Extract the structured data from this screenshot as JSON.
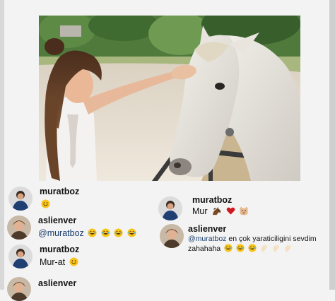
{
  "post": {
    "photo_alt_subjects": [
      "woman",
      "white-horse"
    ]
  },
  "comments_left": [
    {
      "username": "muratboz",
      "text": "",
      "emojis": [
        "smile-emoji"
      ]
    },
    {
      "username": "aslienver",
      "mention": "@muratboz",
      "text": "",
      "emojis": [
        "laugh-cry-emoji",
        "laugh-cry-emoji",
        "laugh-cry-emoji",
        "laugh-cry-emoji"
      ]
    },
    {
      "username": "muratboz",
      "text": "Mur-at",
      "emojis": [
        "smile-emoji"
      ]
    },
    {
      "username": "aslienver",
      "text": ""
    }
  ],
  "comments_right": [
    {
      "username": "muratboz",
      "text": "Mur",
      "emojis": [
        "horse-emoji",
        "red-heart-emoji",
        "cat-face-emoji"
      ]
    },
    {
      "username": "aslienver",
      "mention": "@muratboz",
      "text": "en çok yaraticiligini sevdim",
      "text2": "zahahaha",
      "emojis": [
        "laugh-cry-emoji",
        "laugh-cry-emoji",
        "laugh-cry-emoji",
        "clap-emoji",
        "clap-emoji",
        "clap-emoji"
      ]
    }
  ],
  "colors": {
    "mention": "#1a3d6e",
    "heart": "#d0181e",
    "emoji_yellow": "#f7c21b"
  }
}
